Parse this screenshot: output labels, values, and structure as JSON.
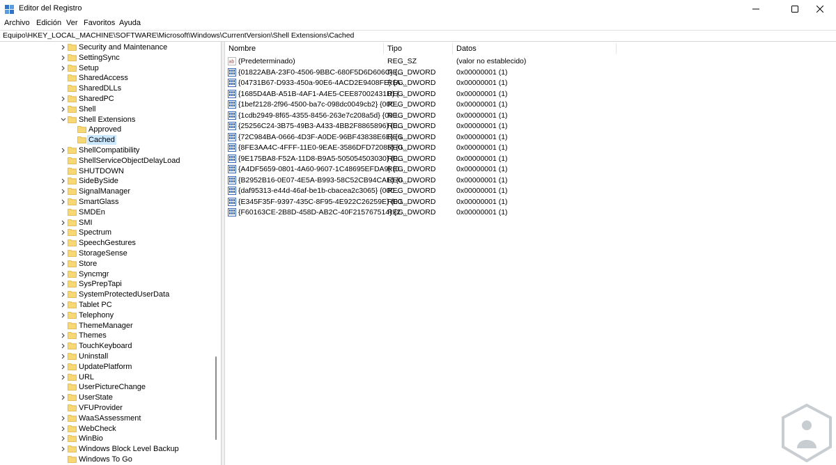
{
  "window": {
    "title": "Editor del Registro",
    "controls": [
      "minimize",
      "maximize",
      "close"
    ]
  },
  "menu": [
    "Archivo",
    "Edición",
    "Ver",
    "Favoritos",
    "Ayuda"
  ],
  "address": "Equipo\\HKEY_LOCAL_MACHINE\\SOFTWARE\\Microsoft\\Windows\\CurrentVersion\\Shell Extensions\\Cached",
  "tree": [
    {
      "label": "Security and Maintenance",
      "level": 0,
      "chevron": "right"
    },
    {
      "label": "SettingSync",
      "level": 0,
      "chevron": "right"
    },
    {
      "label": "Setup",
      "level": 0,
      "chevron": "right"
    },
    {
      "label": "SharedAccess",
      "level": 0,
      "chevron": "none"
    },
    {
      "label": "SharedDLLs",
      "level": 0,
      "chevron": "none"
    },
    {
      "label": "SharedPC",
      "level": 0,
      "chevron": "right"
    },
    {
      "label": "Shell",
      "level": 0,
      "chevron": "right"
    },
    {
      "label": "Shell Extensions",
      "level": 0,
      "chevron": "down"
    },
    {
      "label": "Approved",
      "level": 1,
      "chevron": "none"
    },
    {
      "label": "Cached",
      "level": 1,
      "chevron": "none",
      "selected": true
    },
    {
      "label": "ShellCompatibility",
      "level": 0,
      "chevron": "right"
    },
    {
      "label": "ShellServiceObjectDelayLoad",
      "level": 0,
      "chevron": "none"
    },
    {
      "label": "SHUTDOWN",
      "level": 0,
      "chevron": "none"
    },
    {
      "label": "SideBySide",
      "level": 0,
      "chevron": "right"
    },
    {
      "label": "SignalManager",
      "level": 0,
      "chevron": "right"
    },
    {
      "label": "SmartGlass",
      "level": 0,
      "chevron": "right"
    },
    {
      "label": "SMDEn",
      "level": 0,
      "chevron": "none"
    },
    {
      "label": "SMI",
      "level": 0,
      "chevron": "right"
    },
    {
      "label": "Spectrum",
      "level": 0,
      "chevron": "right"
    },
    {
      "label": "SpeechGestures",
      "level": 0,
      "chevron": "right"
    },
    {
      "label": "StorageSense",
      "level": 0,
      "chevron": "right"
    },
    {
      "label": "Store",
      "level": 0,
      "chevron": "right"
    },
    {
      "label": "Syncmgr",
      "level": 0,
      "chevron": "right"
    },
    {
      "label": "SysPrepTapi",
      "level": 0,
      "chevron": "right"
    },
    {
      "label": "SystemProtectedUserData",
      "level": 0,
      "chevron": "right"
    },
    {
      "label": "Tablet PC",
      "level": 0,
      "chevron": "right"
    },
    {
      "label": "Telephony",
      "level": 0,
      "chevron": "right"
    },
    {
      "label": "ThemeManager",
      "level": 0,
      "chevron": "none"
    },
    {
      "label": "Themes",
      "level": 0,
      "chevron": "right"
    },
    {
      "label": "TouchKeyboard",
      "level": 0,
      "chevron": "right"
    },
    {
      "label": "Uninstall",
      "level": 0,
      "chevron": "right"
    },
    {
      "label": "UpdatePlatform",
      "level": 0,
      "chevron": "right"
    },
    {
      "label": "URL",
      "level": 0,
      "chevron": "right"
    },
    {
      "label": "UserPictureChange",
      "level": 0,
      "chevron": "none"
    },
    {
      "label": "UserState",
      "level": 0,
      "chevron": "right"
    },
    {
      "label": "VFUProvider",
      "level": 0,
      "chevron": "none"
    },
    {
      "label": "WaaSAssessment",
      "level": 0,
      "chevron": "right"
    },
    {
      "label": "WebCheck",
      "level": 0,
      "chevron": "right"
    },
    {
      "label": "WinBio",
      "level": 0,
      "chevron": "right"
    },
    {
      "label": "Windows Block Level Backup",
      "level": 0,
      "chevron": "right"
    },
    {
      "label": "Windows To Go",
      "level": 0,
      "chevron": "none"
    }
  ],
  "columns": {
    "name": "Nombre",
    "type": "Tipo",
    "data": "Datos"
  },
  "values": [
    {
      "name": "(Predeterminado)",
      "type": "REG_SZ",
      "data": "(valor no establecido)",
      "icon": "string-value-icon"
    },
    {
      "name": "{01822ABA-23F0-4506-9BBC-680F5D6D606C} {...",
      "type": "REG_DWORD",
      "data": "0x00000001 (1)",
      "icon": "binary-value-icon"
    },
    {
      "name": "{04731B67-D933-450a-90E6-4ACD2E9408FE} {A...",
      "type": "REG_DWORD",
      "data": "0x00000001 (1)",
      "icon": "binary-value-icon"
    },
    {
      "name": "{1685D4AB-A51B-4AF1-A4E5-CEE87002431D} {...",
      "type": "REG_DWORD",
      "data": "0x00000001 (1)",
      "icon": "binary-value-icon"
    },
    {
      "name": "{1bef2128-2f96-4500-ba7c-098dc0049cb2} {000...",
      "type": "REG_DWORD",
      "data": "0x00000001 (1)",
      "icon": "binary-value-icon"
    },
    {
      "name": "{1cdb2949-8f65-4355-8456-263e7c208a5d} {000...",
      "type": "REG_DWORD",
      "data": "0x00000001 (1)",
      "icon": "binary-value-icon"
    },
    {
      "name": "{25256C24-3B75-49B3-A433-4BB2F8865896} {0...",
      "type": "REG_DWORD",
      "data": "0x00000001 (1)",
      "icon": "binary-value-icon"
    },
    {
      "name": "{72C984BA-0666-4D3F-A0DE-96BF43838E6E} {6...",
      "type": "REG_DWORD",
      "data": "0x00000001 (1)",
      "icon": "binary-value-icon"
    },
    {
      "name": "{8FE3AA4C-4FFF-11E0-9EAE-3586DFD72085} {0...",
      "type": "REG_DWORD",
      "data": "0x00000001 (1)",
      "icon": "binary-value-icon"
    },
    {
      "name": "{9E175BA8-F52A-11D8-B9A5-505054503030} {0...",
      "type": "REG_DWORD",
      "data": "0x00000001 (1)",
      "icon": "binary-value-icon"
    },
    {
      "name": "{A4DF5659-0801-4A60-9607-1C48695EFDA9} {0...",
      "type": "REG_DWORD",
      "data": "0x00000001 (1)",
      "icon": "binary-value-icon"
    },
    {
      "name": "{B2952B16-0E07-4E5A-B993-58C52CB94CAE} {0...",
      "type": "REG_DWORD",
      "data": "0x00000001 (1)",
      "icon": "binary-value-icon"
    },
    {
      "name": "{daf95313-e44d-46af-be1b-cbacea2c3065} {000...",
      "type": "REG_DWORD",
      "data": "0x00000001 (1)",
      "icon": "binary-value-icon"
    },
    {
      "name": "{E345F35F-9397-435C-8F95-4E922C26259E} {00...",
      "type": "REG_DWORD",
      "data": "0x00000001 (1)",
      "icon": "binary-value-icon"
    },
    {
      "name": "{F60163CE-2B8D-458D-AB2C-40F215767514} {2...",
      "type": "REG_DWORD",
      "data": "0x00000001 (1)",
      "icon": "binary-value-icon"
    }
  ],
  "colors": {
    "selection": "#cce8ff",
    "folder": "#f8d775",
    "folder_edge": "#dcb03c",
    "accent": "#2f74c7"
  }
}
